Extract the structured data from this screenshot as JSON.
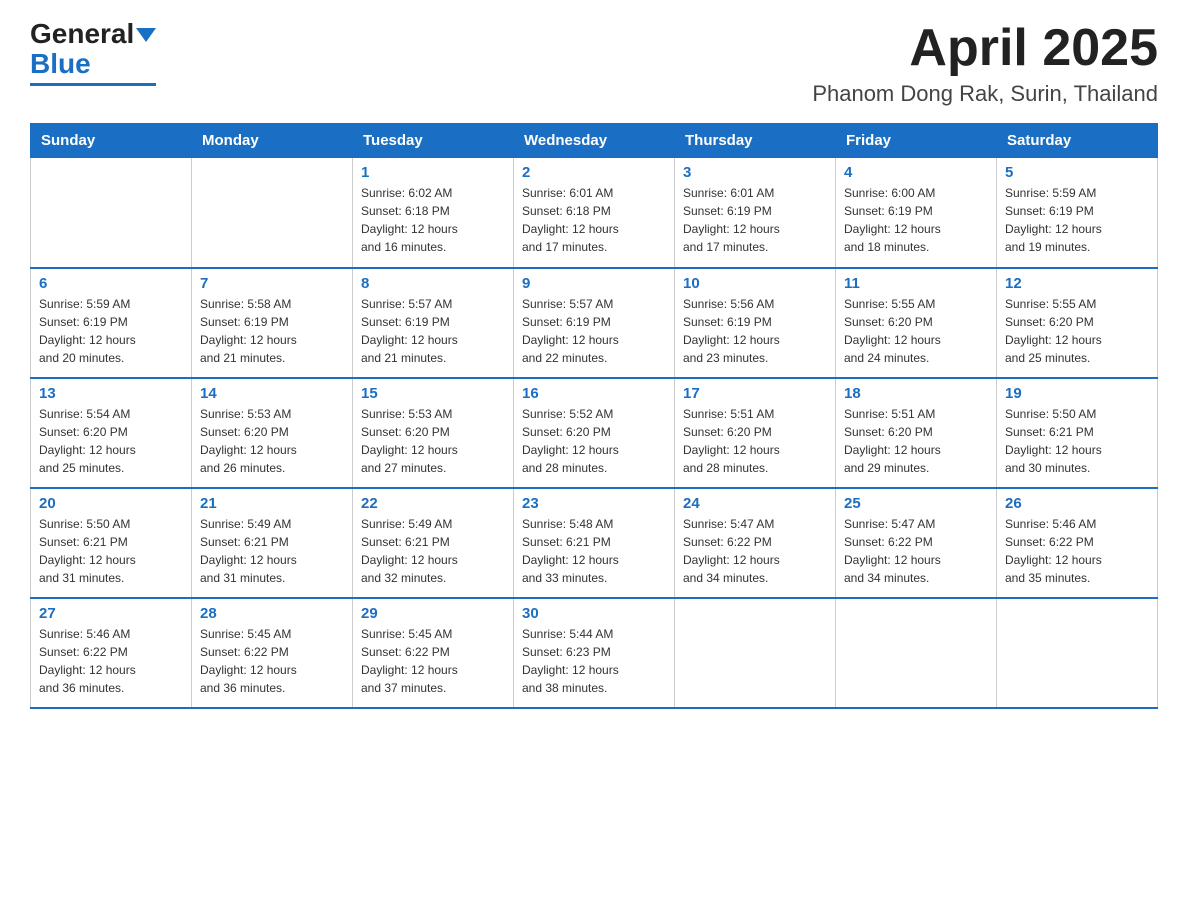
{
  "header": {
    "logo_general": "General",
    "logo_blue": "Blue",
    "month_title": "April 2025",
    "location": "Phanom Dong Rak, Surin, Thailand"
  },
  "weekdays": [
    "Sunday",
    "Monday",
    "Tuesday",
    "Wednesday",
    "Thursday",
    "Friday",
    "Saturday"
  ],
  "weeks": [
    [
      {
        "day": "",
        "info": ""
      },
      {
        "day": "",
        "info": ""
      },
      {
        "day": "1",
        "info": "Sunrise: 6:02 AM\nSunset: 6:18 PM\nDaylight: 12 hours\nand 16 minutes."
      },
      {
        "day": "2",
        "info": "Sunrise: 6:01 AM\nSunset: 6:18 PM\nDaylight: 12 hours\nand 17 minutes."
      },
      {
        "day": "3",
        "info": "Sunrise: 6:01 AM\nSunset: 6:19 PM\nDaylight: 12 hours\nand 17 minutes."
      },
      {
        "day": "4",
        "info": "Sunrise: 6:00 AM\nSunset: 6:19 PM\nDaylight: 12 hours\nand 18 minutes."
      },
      {
        "day": "5",
        "info": "Sunrise: 5:59 AM\nSunset: 6:19 PM\nDaylight: 12 hours\nand 19 minutes."
      }
    ],
    [
      {
        "day": "6",
        "info": "Sunrise: 5:59 AM\nSunset: 6:19 PM\nDaylight: 12 hours\nand 20 minutes."
      },
      {
        "day": "7",
        "info": "Sunrise: 5:58 AM\nSunset: 6:19 PM\nDaylight: 12 hours\nand 21 minutes."
      },
      {
        "day": "8",
        "info": "Sunrise: 5:57 AM\nSunset: 6:19 PM\nDaylight: 12 hours\nand 21 minutes."
      },
      {
        "day": "9",
        "info": "Sunrise: 5:57 AM\nSunset: 6:19 PM\nDaylight: 12 hours\nand 22 minutes."
      },
      {
        "day": "10",
        "info": "Sunrise: 5:56 AM\nSunset: 6:19 PM\nDaylight: 12 hours\nand 23 minutes."
      },
      {
        "day": "11",
        "info": "Sunrise: 5:55 AM\nSunset: 6:20 PM\nDaylight: 12 hours\nand 24 minutes."
      },
      {
        "day": "12",
        "info": "Sunrise: 5:55 AM\nSunset: 6:20 PM\nDaylight: 12 hours\nand 25 minutes."
      }
    ],
    [
      {
        "day": "13",
        "info": "Sunrise: 5:54 AM\nSunset: 6:20 PM\nDaylight: 12 hours\nand 25 minutes."
      },
      {
        "day": "14",
        "info": "Sunrise: 5:53 AM\nSunset: 6:20 PM\nDaylight: 12 hours\nand 26 minutes."
      },
      {
        "day": "15",
        "info": "Sunrise: 5:53 AM\nSunset: 6:20 PM\nDaylight: 12 hours\nand 27 minutes."
      },
      {
        "day": "16",
        "info": "Sunrise: 5:52 AM\nSunset: 6:20 PM\nDaylight: 12 hours\nand 28 minutes."
      },
      {
        "day": "17",
        "info": "Sunrise: 5:51 AM\nSunset: 6:20 PM\nDaylight: 12 hours\nand 28 minutes."
      },
      {
        "day": "18",
        "info": "Sunrise: 5:51 AM\nSunset: 6:20 PM\nDaylight: 12 hours\nand 29 minutes."
      },
      {
        "day": "19",
        "info": "Sunrise: 5:50 AM\nSunset: 6:21 PM\nDaylight: 12 hours\nand 30 minutes."
      }
    ],
    [
      {
        "day": "20",
        "info": "Sunrise: 5:50 AM\nSunset: 6:21 PM\nDaylight: 12 hours\nand 31 minutes."
      },
      {
        "day": "21",
        "info": "Sunrise: 5:49 AM\nSunset: 6:21 PM\nDaylight: 12 hours\nand 31 minutes."
      },
      {
        "day": "22",
        "info": "Sunrise: 5:49 AM\nSunset: 6:21 PM\nDaylight: 12 hours\nand 32 minutes."
      },
      {
        "day": "23",
        "info": "Sunrise: 5:48 AM\nSunset: 6:21 PM\nDaylight: 12 hours\nand 33 minutes."
      },
      {
        "day": "24",
        "info": "Sunrise: 5:47 AM\nSunset: 6:22 PM\nDaylight: 12 hours\nand 34 minutes."
      },
      {
        "day": "25",
        "info": "Sunrise: 5:47 AM\nSunset: 6:22 PM\nDaylight: 12 hours\nand 34 minutes."
      },
      {
        "day": "26",
        "info": "Sunrise: 5:46 AM\nSunset: 6:22 PM\nDaylight: 12 hours\nand 35 minutes."
      }
    ],
    [
      {
        "day": "27",
        "info": "Sunrise: 5:46 AM\nSunset: 6:22 PM\nDaylight: 12 hours\nand 36 minutes."
      },
      {
        "day": "28",
        "info": "Sunrise: 5:45 AM\nSunset: 6:22 PM\nDaylight: 12 hours\nand 36 minutes."
      },
      {
        "day": "29",
        "info": "Sunrise: 5:45 AM\nSunset: 6:22 PM\nDaylight: 12 hours\nand 37 minutes."
      },
      {
        "day": "30",
        "info": "Sunrise: 5:44 AM\nSunset: 6:23 PM\nDaylight: 12 hours\nand 38 minutes."
      },
      {
        "day": "",
        "info": ""
      },
      {
        "day": "",
        "info": ""
      },
      {
        "day": "",
        "info": ""
      }
    ]
  ]
}
